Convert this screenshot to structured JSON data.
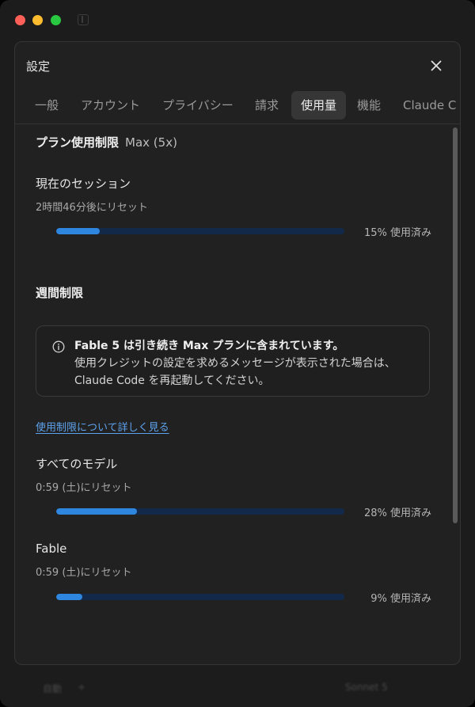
{
  "dialog": {
    "title": "設定",
    "tabs": [
      {
        "label": "一般"
      },
      {
        "label": "アカウント"
      },
      {
        "label": "プライバシー"
      },
      {
        "label": "請求"
      },
      {
        "label": "使用量",
        "active": true
      },
      {
        "label": "機能"
      },
      {
        "label": "Claude C"
      }
    ]
  },
  "plan": {
    "heading": "プラン使用制限",
    "name": "Max (5x)"
  },
  "session": {
    "label": "現在のセッション",
    "reset": "2時間46分後にリセット",
    "percent": 15,
    "used_text": "15% 使用済み"
  },
  "weekly": {
    "heading": "週間制限",
    "notice": {
      "title": "Fable 5 は引き続き Max プランに含まれています。",
      "body": "使用クレジットの設定を求めるメッセージが表示された場合は、Claude Code を再起動してください。"
    },
    "learn_more": "使用制限について詳しく見る",
    "all_models": {
      "label": "すべてのモデル",
      "reset": "0:59 (土)にリセット",
      "percent": 28,
      "used_text": "28% 使用済み"
    },
    "fable": {
      "label": "Fable",
      "reset": "0:59 (土)にリセット",
      "percent": 9,
      "used_text": "9% 使用済み"
    }
  },
  "bottom": {
    "mode": "自動",
    "plus": "+",
    "model": "Sonnet 5"
  },
  "colors": {
    "accent": "#2f86de",
    "track": "#13294a",
    "link": "#5da2ee"
  }
}
